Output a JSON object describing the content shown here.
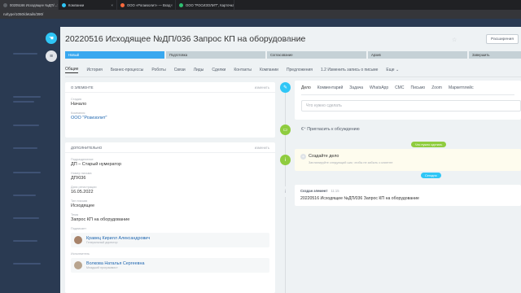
{
  "browser": {
    "tabs": [
      {
        "label": "00205166 Исходящее №ДП/...",
        "color": "#5f6368",
        "active": true
      },
      {
        "label": "Компании",
        "color": "#2fc6f6",
        "active": false
      },
      {
        "label": "ООО «Рогаизолит» — Вход",
        "color": "#ff6a3d",
        "active": false
      },
      {
        "label": "ООО \"РОСИЗОЛИТ\", Карточка",
        "color": "#2fbf71",
        "active": false
      }
    ],
    "url": "ru/type/1050/details/390/"
  },
  "page": {
    "title": "20220516 Исходящее №ДП/036 Запрос КП на оборудование",
    "extensions_button": "Расширения"
  },
  "stages": [
    "Новый",
    "Подготовка",
    "Согласование",
    "Архив",
    "Завершить"
  ],
  "tabs": [
    "Общие",
    "История",
    "Бизнес-процессы",
    "Роботы",
    "Связи",
    "Лиды",
    "Сделки",
    "Контакты",
    "Компании",
    "Предложения",
    "1.2 Изменить запись о письме",
    "Еще"
  ],
  "about": {
    "header": "О ЭЛЕМЕНТЕ",
    "edit": "изменить",
    "stage_label": "Стадия",
    "stage_value": "Начало",
    "company_label": "Компания",
    "company_value": "ООО \"Розизолит\""
  },
  "extra": {
    "header": "ДОПОЛНИТЕЛЬНО",
    "edit": "изменить",
    "fields": [
      {
        "label": "Подразделение",
        "value": "ДП – Старый нумератор"
      },
      {
        "label": "Номер письма",
        "value": "ДП/036"
      },
      {
        "label": "Дата регистрации",
        "value": "16.05.2022"
      },
      {
        "label": "Тип письма",
        "value": "Исходящее"
      },
      {
        "label": "Тема",
        "value": "Запрос КП на оборудование"
      }
    ],
    "signer_label": "Подписант",
    "signer_name": "Кравец Кирилл Александрович",
    "signer_role": "Генеральный директор",
    "executor_label": "Исполнитель",
    "executor_name": "Волкова Наталья Сергеевна",
    "executor_role": "Младший программист"
  },
  "timeline": {
    "editor_tabs": [
      "Дело",
      "Комментарий",
      "Задача",
      "WhatsApp",
      "СМС",
      "Письмо",
      "Zoom",
      "Маркетплейс"
    ],
    "editor_placeholder": "Что нужно сделать",
    "invite": "Пригласить к обсуждению",
    "todo_pill": "Что нужно сделать",
    "todo_title": "Создайте дело",
    "todo_hint": "Запланируйте следующий шаг, чтобы не забыть о клиенте",
    "today_pill": "Сегодня",
    "created_header": "Создан элемент",
    "created_time": "11:15",
    "created_body": "20220516 Исходящее №ДП/036 Запрос КП на оборудование"
  }
}
